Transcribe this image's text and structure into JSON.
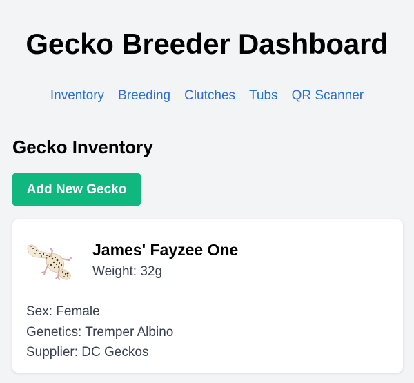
{
  "header": {
    "title": "Gecko Breeder Dashboard"
  },
  "nav": {
    "items": [
      {
        "label": "Inventory"
      },
      {
        "label": "Breeding"
      },
      {
        "label": "Clutches"
      },
      {
        "label": "Tubs"
      },
      {
        "label": "QR Scanner"
      }
    ]
  },
  "main": {
    "section_title": "Gecko Inventory",
    "add_button_label": "Add New Gecko",
    "geckos": [
      {
        "name": "James' Fayzee One",
        "weight": "Weight: 32g",
        "sex": "Sex: Female",
        "genetics": "Genetics: Tremper Albino",
        "supplier": "Supplier: DC Geckos",
        "photo_icon": "leopard-gecko-photo"
      }
    ]
  },
  "colors": {
    "background": "#f3f4f6",
    "link": "#2b6fd1",
    "primary_button": "#10b77f",
    "card": "#ffffff"
  }
}
